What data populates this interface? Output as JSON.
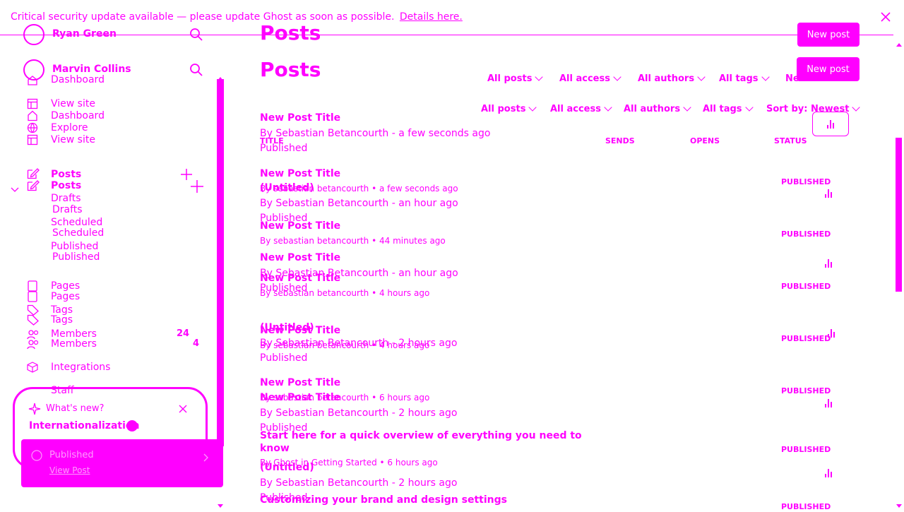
{
  "banner": {
    "text": "Critical security update available — please update Ghost as soon as possible.",
    "link": "Details here."
  },
  "sidebar": {
    "users": [
      "Ryan Green",
      "Marvin Collins"
    ],
    "nav": {
      "dashboard_1": "Dashboard",
      "view_site_1": "View site",
      "dashboard_2": "Dashboard",
      "explore": "Explore",
      "view_site_2": "View site",
      "posts_1": "Posts",
      "posts_2": "Posts",
      "drafts_1": "Drafts",
      "drafts_2": "Drafts",
      "scheduled_1": "Scheduled",
      "scheduled_2": "Scheduled",
      "published_1": "Published",
      "published_2": "Published",
      "pages_1": "Pages",
      "pages_2": "Pages",
      "tags_1": "Tags",
      "tags_2": "Tags",
      "members_1": "Members",
      "members_count_1": "24",
      "members_2": "Members",
      "members_count_2": "4",
      "integrations": "Integrations",
      "staff": "Staff"
    },
    "whats_new": {
      "title": "What's new?",
      "item": "Internationalization"
    },
    "toast": {
      "title": "Published",
      "action": "View Post"
    }
  },
  "main": {
    "title_1": "Posts",
    "title_2": "Posts",
    "new_post_1": "New post",
    "new_post_2": "New post",
    "filters_1": [
      "All posts",
      "All access",
      "All authors",
      "All tags",
      "Newest first"
    ],
    "filters_2": [
      "All posts",
      "All access",
      "All authors",
      "All tags",
      "Sort by: Newest"
    ],
    "columns": [
      "TITLE",
      "SENDS",
      "OPENS",
      "STATUS"
    ],
    "posts_a": [
      {
        "title": "New Post Title",
        "meta": "By Sebastian Betancourth - a few seconds ago",
        "status": "Published"
      },
      {
        "title": "New Post Title",
        "meta": "By Sebastian Betancourth - an hour ago",
        "status": "Published"
      },
      {
        "title": "New Post Title",
        "meta": "By Sebastian Betancourth - an hour ago",
        "status": "Published"
      },
      {
        "title": "New Post Title",
        "meta": "By Sebastian Betancourth - 2 hours ago",
        "status": "Published"
      },
      {
        "title": "New Post Title",
        "meta": "By Sebastian Betancourth - 2 hours ago",
        "status": "Published"
      },
      {
        "title": "(Untitled)",
        "meta": "By Sebastian Betancourth - 2 hours ago",
        "status": "Published"
      }
    ],
    "posts_b": [
      {
        "title": "(Untitled)",
        "meta": "By sebastian betancourth • a few seconds ago",
        "status": "PUBLISHED"
      },
      {
        "title": "New Post Title",
        "meta": "By sebastian betancourth • 44 minutes ago",
        "status": "PUBLISHED"
      },
      {
        "title": "New Post Title",
        "meta": "By sebastian betancourth • 4 hours ago",
        "status": "PUBLISHED"
      },
      {
        "title": "New Post Title",
        "meta": "By sebastian betancourth • 4 hours ago",
        "status": "PUBLISHED"
      },
      {
        "title": "New Post Title",
        "meta": "By sebastian betancourth • 6 hours ago",
        "status": "PUBLISHED"
      },
      {
        "title": "Start here for a quick overview of everything you need to know",
        "meta": "By Ghost in Getting Started • 6 hours ago",
        "status": "PUBLISHED"
      },
      {
        "title": "Customizing your brand and design settings",
        "meta": "",
        "status": "PUBLISHED"
      }
    ],
    "extra_title_1": "(Untitled)",
    "extra_title_2": "New Post Title"
  }
}
